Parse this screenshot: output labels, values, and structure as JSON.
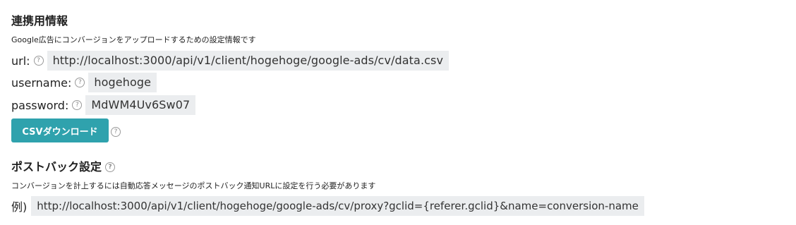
{
  "integration": {
    "title": "連携用情報",
    "description": "Google広告にコンバージョンをアップロードするための設定情報です",
    "fields": [
      {
        "label": "url:",
        "value": "http://localhost:3000/api/v1/client/hogehoge/google-ads/cv/data.csv"
      },
      {
        "label": "username:",
        "value": "hogehoge"
      },
      {
        "label": "password:",
        "value": "MdWM4Uv6Sw07"
      }
    ],
    "csv_button_label": "CSVダウンロード"
  },
  "postback": {
    "title": "ポストバック設定",
    "description": "コンバージョンを計上するには自動応答メッセージのポストバック通知URLに設定を行う必要があります",
    "example_label": "例)",
    "example_value": "http://localhost:3000/api/v1/client/hogehoge/google-ads/cv/proxy?gclid={referer.gclid}&name=conversion-name"
  },
  "help_icon_glyph": "?",
  "colors": {
    "accent": "#2fa2ad",
    "value_background": "#ebedef"
  }
}
